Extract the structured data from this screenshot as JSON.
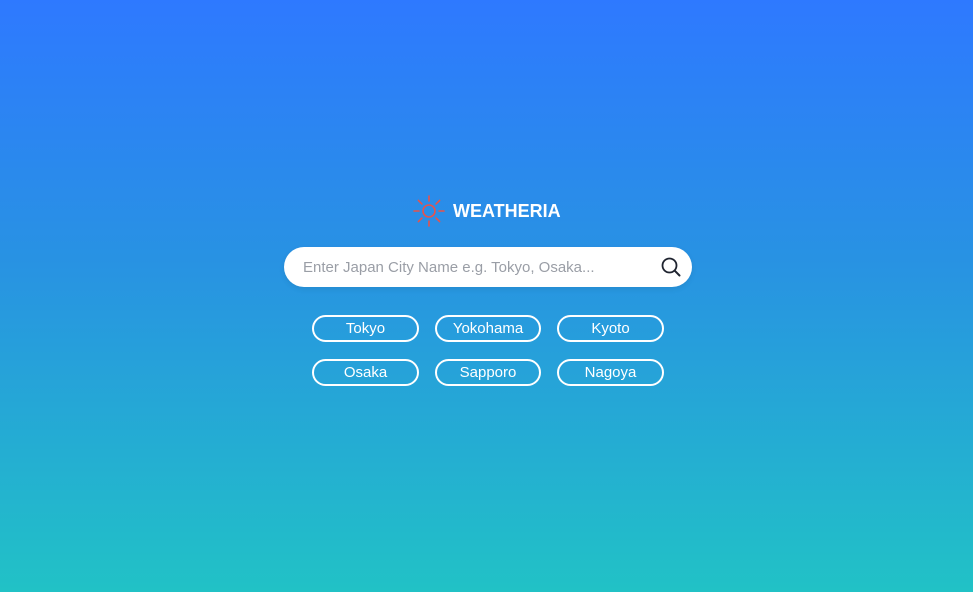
{
  "app": {
    "title": "WEATHERIA",
    "logo_icon": "sun-icon",
    "logo_color": "#e8524a"
  },
  "search": {
    "placeholder": "Enter Japan City Name e.g. Tokyo, Osaka...",
    "value": "",
    "icon": "search-icon"
  },
  "cities": [
    {
      "label": "Tokyo"
    },
    {
      "label": "Yokohama"
    },
    {
      "label": "Kyoto"
    },
    {
      "label": "Osaka"
    },
    {
      "label": "Sapporo"
    },
    {
      "label": "Nagoya"
    }
  ],
  "colors": {
    "gradient_top": "#2e79ff",
    "gradient_bottom": "#21c2c6",
    "chip_border": "#ffffff"
  }
}
